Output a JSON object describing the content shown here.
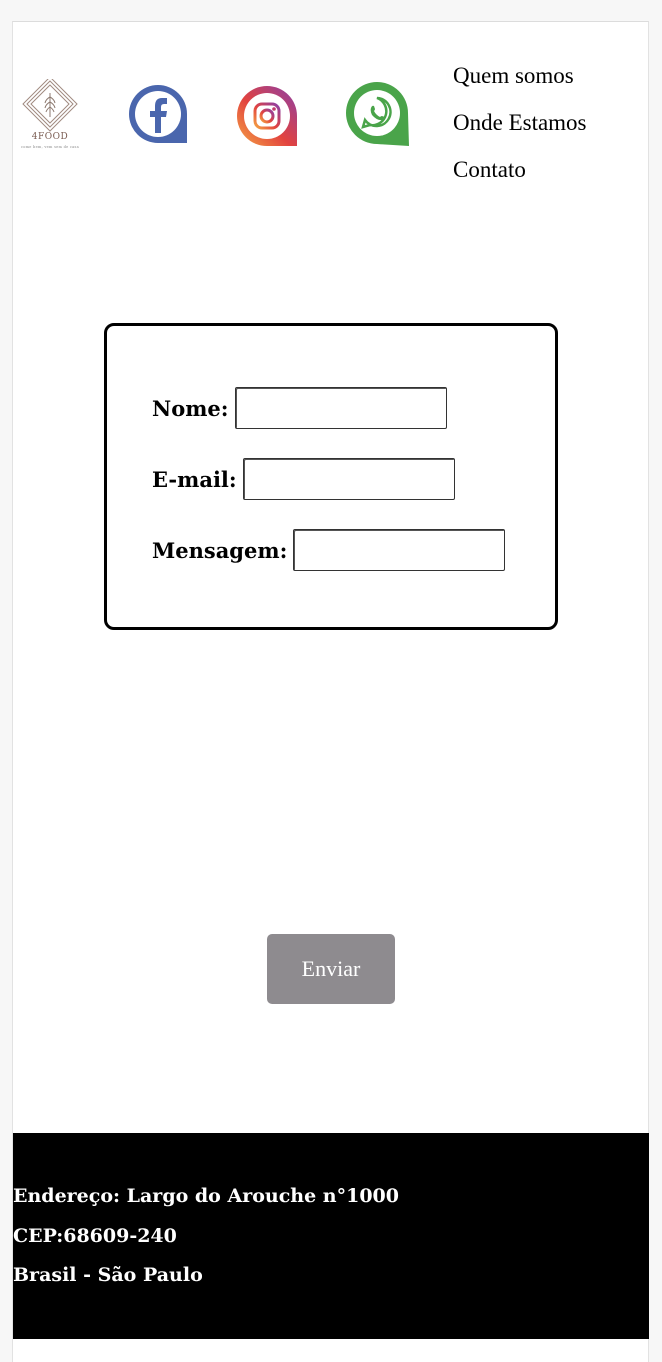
{
  "brand": {
    "name": "4FOOD",
    "tagline": "come bem, vem sem de casa",
    "colors": {
      "logo_line": "#a08a80",
      "logo_text": "#7a5c52"
    }
  },
  "social": {
    "facebook_icon": "facebook-icon",
    "instagram_icon": "instagram-icon",
    "whatsapp_icon": "whatsapp-icon",
    "colors": {
      "facebook": "#4a66ad",
      "whatsapp": "#4aa44a",
      "instagram_start": "#f5a443",
      "instagram_end": "#8b3fa8"
    }
  },
  "nav": {
    "items": [
      {
        "label": "Quem somos"
      },
      {
        "label": "Onde Estamos"
      },
      {
        "label": "Contato"
      }
    ]
  },
  "form": {
    "nome": {
      "label": "Nome:",
      "value": ""
    },
    "email": {
      "label": "E-mail:",
      "value": ""
    },
    "mensagem": {
      "label": "Mensagem:",
      "value": ""
    },
    "submit_label": "Enviar",
    "submit_color": "#8e8b8f"
  },
  "footer": {
    "address": "Endereço: Largo do Arouche n°1000",
    "cep": "CEP:68609-240",
    "country": "Brasil - São Paulo",
    "background": "#000000"
  }
}
